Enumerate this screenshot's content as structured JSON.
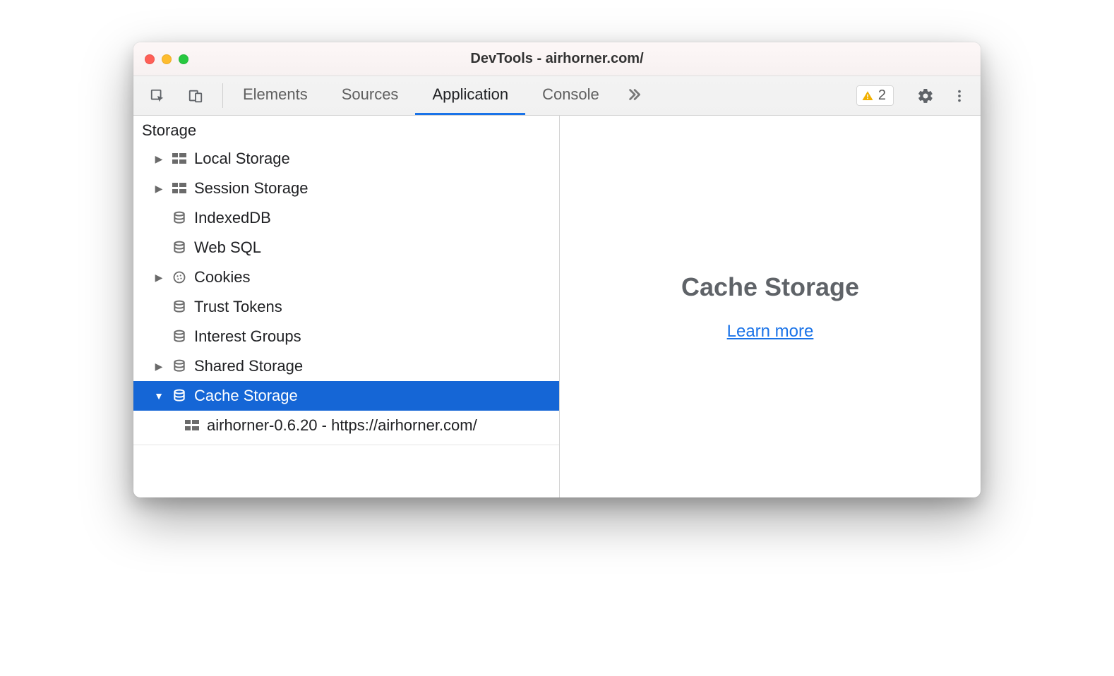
{
  "window": {
    "title": "DevTools - airhorner.com/"
  },
  "toolbar": {
    "tabs": [
      {
        "label": "Elements",
        "active": false
      },
      {
        "label": "Sources",
        "active": false
      },
      {
        "label": "Application",
        "active": true
      },
      {
        "label": "Console",
        "active": false
      }
    ],
    "overflow_icon": "chevrons-right",
    "warnings_count": "2"
  },
  "sidebar": {
    "section": "Storage",
    "items": [
      {
        "label": "Local Storage",
        "icon": "grid",
        "expandable": true,
        "expanded": false,
        "selected": false
      },
      {
        "label": "Session Storage",
        "icon": "grid",
        "expandable": true,
        "expanded": false,
        "selected": false
      },
      {
        "label": "IndexedDB",
        "icon": "database",
        "expandable": false,
        "expanded": false,
        "selected": false
      },
      {
        "label": "Web SQL",
        "icon": "database",
        "expandable": false,
        "expanded": false,
        "selected": false
      },
      {
        "label": "Cookies",
        "icon": "cookie",
        "expandable": true,
        "expanded": false,
        "selected": false
      },
      {
        "label": "Trust Tokens",
        "icon": "database",
        "expandable": false,
        "expanded": false,
        "selected": false
      },
      {
        "label": "Interest Groups",
        "icon": "database",
        "expandable": false,
        "expanded": false,
        "selected": false
      },
      {
        "label": "Shared Storage",
        "icon": "database",
        "expandable": true,
        "expanded": false,
        "selected": false
      },
      {
        "label": "Cache Storage",
        "icon": "database",
        "expandable": true,
        "expanded": true,
        "selected": true
      }
    ],
    "cache_children": [
      {
        "label": "airhorner-0.6.20 - https://airhorner.com/",
        "icon": "grid"
      }
    ]
  },
  "main": {
    "heading": "Cache Storage",
    "link_label": "Learn more"
  },
  "colors": {
    "selection": "#1566d6",
    "accent": "#1a73e8",
    "muted": "#5f6368"
  }
}
